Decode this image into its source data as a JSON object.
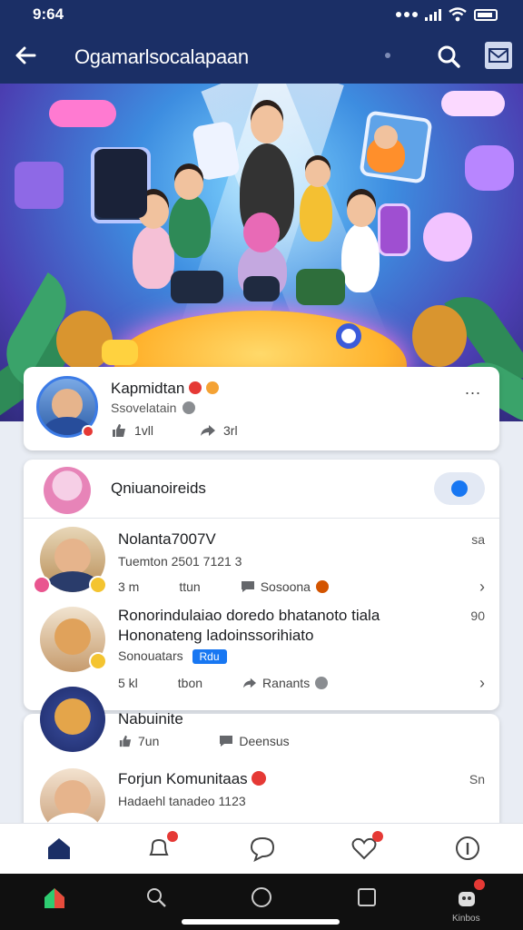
{
  "status_bar": {
    "time": "9:64"
  },
  "header": {
    "title": "Ogamarlsocalapaan"
  },
  "profile": {
    "name": "Kapmidtan",
    "subtitle": "Ssovelatain",
    "likes": "1vll",
    "shares": "3rl",
    "more": "..."
  },
  "composer": {
    "placeholder": "Qniuanoireids"
  },
  "posts": [
    {
      "title": "Nolanta7007V",
      "meta": "Tuemton 2501 7121 3",
      "side": "sa",
      "likes": "3 m",
      "comment": "ttun",
      "share": "Sosoona"
    },
    {
      "title": "Ronorindulaiao doredo bhatanoto tiala",
      "subtitle": "Hononateng ladoinssorihiato",
      "meta": "Sonouatars",
      "tag": "Rdu",
      "side": "90",
      "likes": "5 kl",
      "comment": "tbon",
      "share": "Ranants"
    },
    {
      "title": "Nabuinite",
      "likes": "7un",
      "share": "Deensus"
    },
    {
      "title": "Forjun Komunitaas",
      "meta": "Hadaehl tanadeo 1123",
      "side": "Sn"
    }
  ],
  "sysnav": {
    "label": "Kinbos"
  },
  "colors": {
    "header": "#1b2f66",
    "accent": "#1877f2",
    "badge": "#e53935"
  }
}
